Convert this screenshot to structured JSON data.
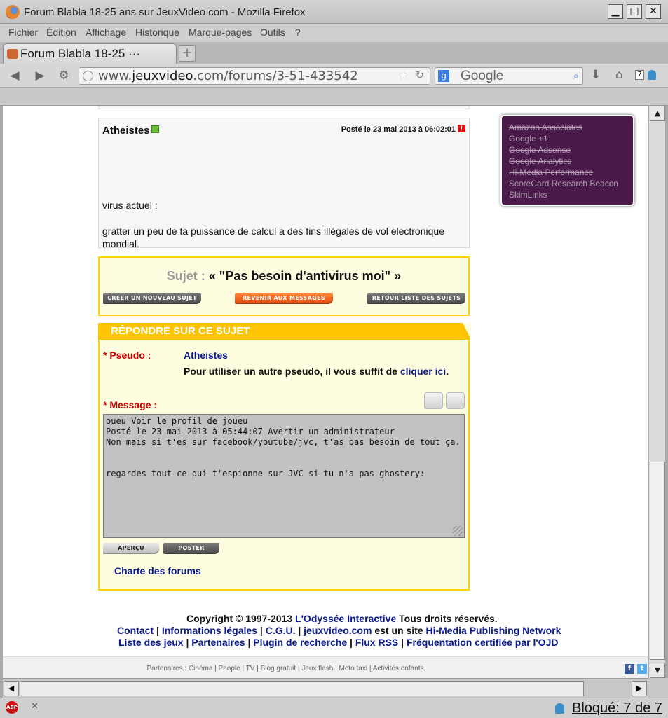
{
  "window": {
    "title": "Forum Blabla 18-25 ans sur JeuxVideo.com - Mozilla Firefox",
    "minimize_glyph": "▁",
    "maximize_glyph": "□",
    "close_glyph": "✕"
  },
  "menu": [
    "Fichier",
    "Édition",
    "Affichage",
    "Historique",
    "Marque-pages",
    "Outils",
    "?"
  ],
  "tab": {
    "label": "Forum Blabla 18-25 ···",
    "new_tab_glyph": "+"
  },
  "nav": {
    "url_prefix": "www.",
    "url_domain": "jeuxvideo",
    "url_rest": ".com/forums/3-51-433542",
    "search_engine_letter": "g",
    "search_placeholder": "Google",
    "badge_count": "7"
  },
  "post": {
    "author": "Atheistes",
    "date": "Posté le 23 mai 2013 à 06:02:01",
    "line1": "virus actuel :",
    "line2": "gratter un peu de ta puissance de calcul a des fins illégales de vol electronique mondial."
  },
  "sujet": {
    "label": "Sujet :",
    "title": "« \"Pas besoin d'antivirus moi\" »",
    "btn_new": "CREER UN NOUVEAU SUJET",
    "btn_back": "REVENIR AUX MESSAGES",
    "btn_list": "RETOUR LISTE DES SUJETS"
  },
  "reply": {
    "header": "RÉPONDRE SUR CE SUJET",
    "pseudo_label": "* Pseudo :",
    "pseudo_value": "Atheistes",
    "pseudo_hint": "Pour utiliser un autre pseudo, il vous suffit de ",
    "pseudo_link": "cliquer ici",
    "pseudo_hint_end": ".",
    "message_label": "* Message :",
    "message": "oueu Voir le profil de joueu\nPosté le 23 mai 2013 à 05:44:07 Avertir un administrateur\nNon mais si t'es sur facebook/youtube/jvc, t'as pas besoin de tout ça.\n\n\nregardes tout ce qui t'espionne sur JVC si tu n'a pas ghostery:",
    "btn_preview": "APERÇU",
    "btn_post": "POSTER",
    "charte": "Charte des forums"
  },
  "footer": {
    "copyright_pre": "Copyright © 1997-2013 ",
    "copyright_link": "L'Odyssée Interactive",
    "copyright_post": " Tous droits réservés.",
    "contact": "Contact",
    "legal": "Informations légales",
    "cgu": "C.G.U.",
    "jv": "jeuxvideo.com",
    "site_text": " est un site ",
    "himedia": "Hi-Media Publishing Network",
    "games": "Liste des jeux",
    "partners": "Partenaires",
    "plugin": "Plugin de recherche",
    "rss": "Flux RSS",
    "ojd": "Fréquentation certifiée par l'OJD",
    "sep": " | ",
    "partner_line": "Partenaires : Cinéma | People | TV | Blog gratuit | Jeux flash | Moto taxi | Activités enfants"
  },
  "ghostery": [
    "Amazon Associates",
    "Google +1",
    "Google Adsense",
    "Google Analytics",
    "Hi-Media Performance",
    "ScoreCard Research Beacon",
    "SkimLinks"
  ],
  "status": {
    "abp": "ABP",
    "close": "✕",
    "blocked": "Bloqué: 7 de 7"
  },
  "colors": {
    "link": "#0a1a8c",
    "accent": "#ffc400",
    "label_red": "#cc0000",
    "ghostery_bg": "#4a1a4a"
  }
}
